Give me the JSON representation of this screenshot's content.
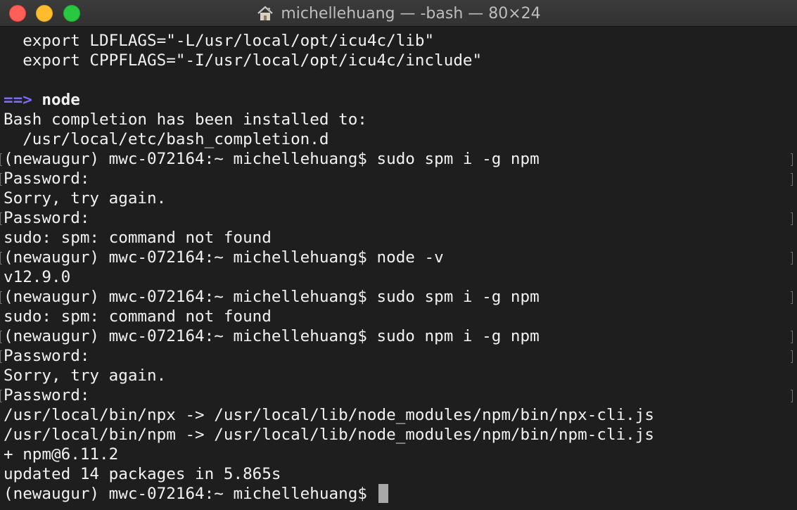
{
  "window": {
    "title": "michellehuang — -bash — 80×24",
    "home_icon": "house-icon"
  },
  "terminal": {
    "lines": [
      {
        "text": "  export LDFLAGS=\"-L/usr/local/opt/icu4c/lib\"",
        "mark": false
      },
      {
        "text": "  export CPPFLAGS=\"-I/usr/local/opt/icu4c/include\"",
        "mark": false
      },
      {
        "text": "",
        "mark": false
      },
      {
        "arrow": "==>",
        "label": "node",
        "mark": false
      },
      {
        "text": "Bash completion has been installed to:",
        "mark": false
      },
      {
        "text": "  /usr/local/etc/bash_completion.d",
        "mark": false
      },
      {
        "text": "(newaugur) mwc-072164:~ michellehuang$ sudo spm i -g npm",
        "mark": true
      },
      {
        "text": "Password:",
        "mark": true
      },
      {
        "text": "Sorry, try again.",
        "mark": false
      },
      {
        "text": "Password:",
        "mark": true
      },
      {
        "text": "sudo: spm: command not found",
        "mark": false
      },
      {
        "text": "(newaugur) mwc-072164:~ michellehuang$ node -v",
        "mark": true
      },
      {
        "text": "v12.9.0",
        "mark": false
      },
      {
        "text": "(newaugur) mwc-072164:~ michellehuang$ sudo spm i -g npm",
        "mark": true
      },
      {
        "text": "sudo: spm: command not found",
        "mark": false
      },
      {
        "text": "(newaugur) mwc-072164:~ michellehuang$ sudo npm i -g npm",
        "mark": true
      },
      {
        "text": "Password:",
        "mark": true
      },
      {
        "text": "Sorry, try again.",
        "mark": false
      },
      {
        "text": "Password:",
        "mark": true
      },
      {
        "text": "/usr/local/bin/npx -> /usr/local/lib/node_modules/npm/bin/npx-cli.js",
        "mark": false
      },
      {
        "text": "/usr/local/bin/npm -> /usr/local/lib/node_modules/npm/bin/npm-cli.js",
        "mark": false
      },
      {
        "text": "+ npm@6.11.2",
        "mark": false
      },
      {
        "text": "updated 14 packages in 5.865s",
        "mark": false
      },
      {
        "text": "(newaugur) mwc-072164:~ michellehuang$ ",
        "mark": false,
        "cursor": true
      }
    ]
  },
  "colors": {
    "background": "#1e1e1e",
    "text": "#f2f2f2",
    "arrow": "#7b6cf6",
    "close": "#fe5f57",
    "minimize": "#febc2e",
    "zoom": "#28c840"
  }
}
